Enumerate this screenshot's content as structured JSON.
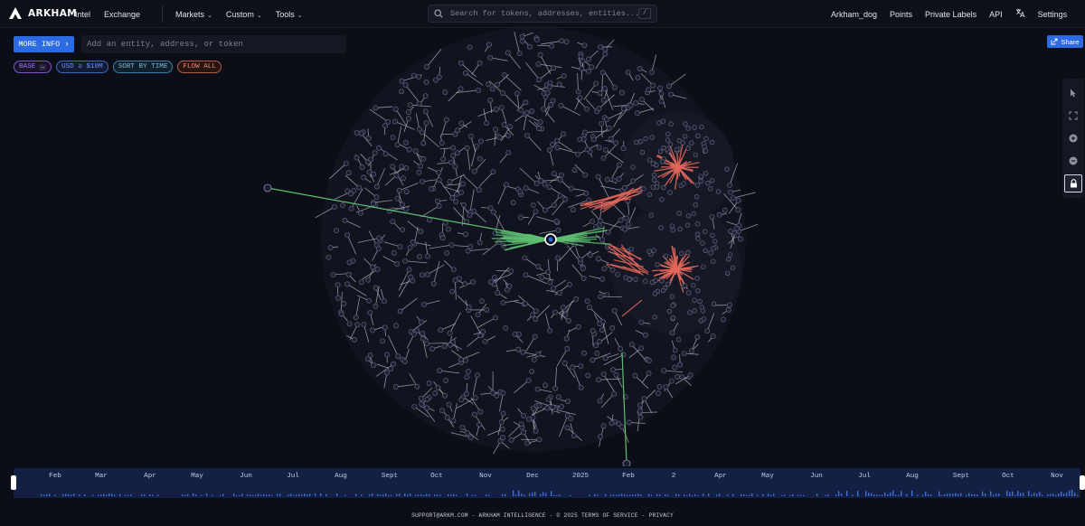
{
  "brand": {
    "name": "ARKHAM"
  },
  "nav": {
    "left": [
      {
        "label": "Intel",
        "dropdown": false
      },
      {
        "label": "Exchange",
        "dropdown": false
      },
      {
        "label": "Markets",
        "dropdown": true
      },
      {
        "label": "Custom",
        "dropdown": true
      },
      {
        "label": "Tools",
        "dropdown": true
      }
    ],
    "search_placeholder": "Search for tokens, addresses, entities...",
    "search_shortcut": "/",
    "right": [
      "Arkham_dog",
      "Points",
      "Private Labels",
      "API"
    ],
    "settings_label": "Settings"
  },
  "toolbar": {
    "more_info_label": "MORE INFO",
    "entity_placeholder": "Add an entity, address, or token",
    "share_label": "Share"
  },
  "filters": {
    "base_label": "BASE",
    "base_value": "—",
    "usd_label": "USD ≥ $10M",
    "sort_label": "SORT BY TIME",
    "flow_label": "FLOW ALL"
  },
  "graph_tools": [
    "pointer-icon",
    "fit-view-icon",
    "zoom-in-icon",
    "zoom-out-icon",
    "lock-icon"
  ],
  "colors": {
    "accent_blue": "#2d6be4",
    "inflow_green": "#5fbf73",
    "outflow_red": "#e4675a",
    "background": "#0b0d17"
  },
  "timeline": {
    "months": [
      "Feb",
      "Mar",
      "Apr",
      "May",
      "Jun",
      "Jul",
      "Aug",
      "Sept",
      "Oct",
      "Nov",
      "Dec",
      "2025",
      "Feb",
      "2",
      "Apr",
      "May",
      "Jun",
      "Jul",
      "Aug",
      "Sept",
      "Oct",
      "Nov"
    ]
  },
  "footer": {
    "left": "SUPPORT@ARKM.COM - ARKHAM INTELLIGENCE - © 2025",
    "terms": "TERMS OF SERVICE",
    "sep": "-",
    "privacy": "PRIVACY"
  }
}
